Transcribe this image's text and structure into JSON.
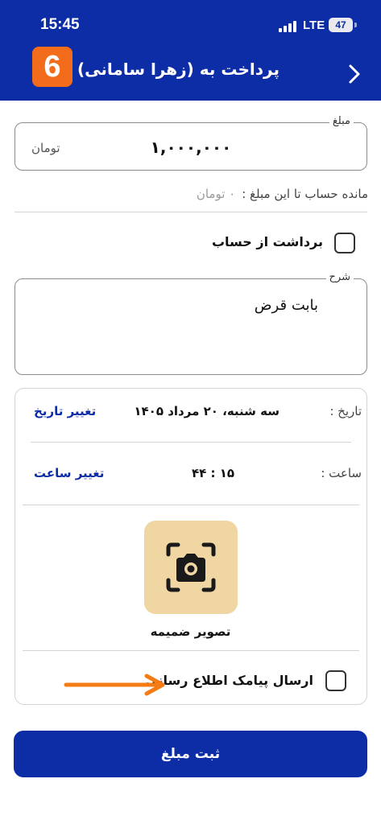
{
  "status_bar": {
    "time": "15:45",
    "network": "LTE",
    "battery": "47"
  },
  "header": {
    "logo_text": "6",
    "title": "پرداخت به (زهرا سامانی)"
  },
  "amount": {
    "legend": "مبلغ",
    "value": "۱,۰۰۰,۰۰۰",
    "unit": "تومان"
  },
  "remaining": {
    "label": "مانده حساب تا این مبلغ :",
    "value": "۰ تومان"
  },
  "withdraw": {
    "label": "برداشت از حساب",
    "checked": false
  },
  "description": {
    "legend": "شرح",
    "value": "بابت قرض"
  },
  "date_row": {
    "label": "تاریخ :",
    "value": "سه شنبه، ۲۰ مرداد ۱۴۰۵",
    "action": "تغییر تاریخ"
  },
  "time_row": {
    "label": "ساعت :",
    "value": "۱۵ : ۴۴",
    "action": "تغییر ساعت"
  },
  "attachment": {
    "label": "تصویر ضمیمه",
    "icon": "camera-scan-icon"
  },
  "sms": {
    "label": "ارسال پیامک اطلاع رسانی",
    "checked": false
  },
  "submit": {
    "label": "ثبت مبلغ"
  },
  "colors": {
    "primary": "#0c2da6",
    "logo": "#f26c1c",
    "camera_bg": "#efd6a3",
    "arrow": "#f57c14"
  }
}
